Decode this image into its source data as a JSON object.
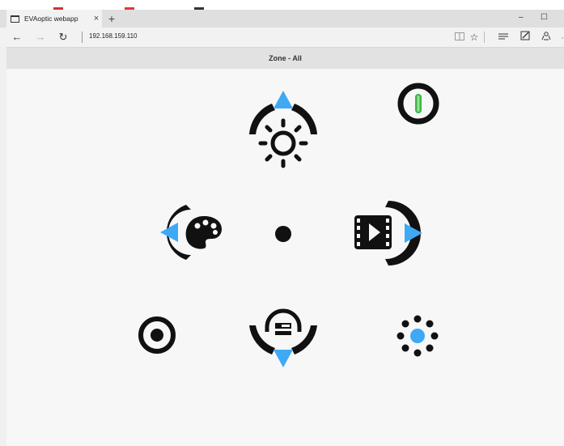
{
  "browser": {
    "tab_title": "EVAoptic webapp",
    "tab_close": "×",
    "new_tab": "+",
    "url": "192.168.159.110",
    "minimize": "–",
    "maximize": "☐"
  },
  "page": {
    "zone_title": "Zone - All"
  },
  "colors": {
    "accent_blue": "#3fa9f5",
    "power_green": "#39b54a",
    "icon_black": "#111111"
  }
}
